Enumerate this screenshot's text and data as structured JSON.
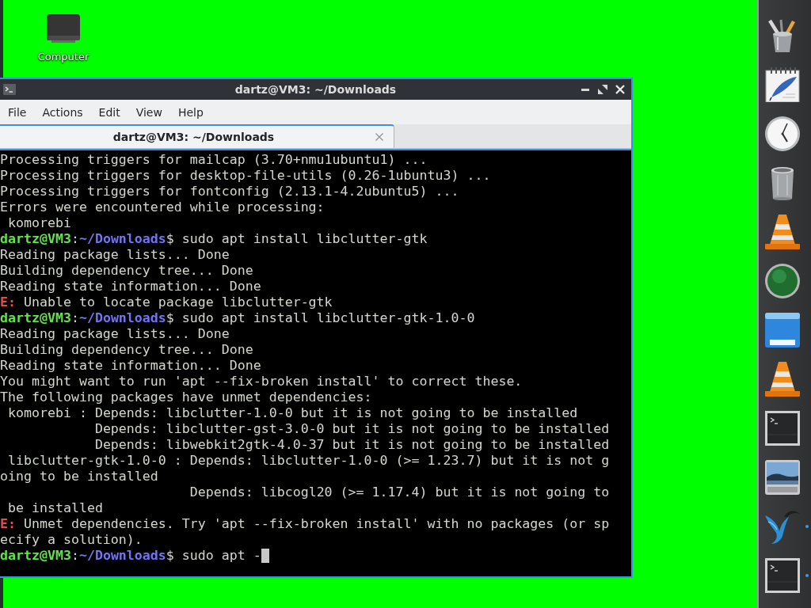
{
  "desktop": {
    "icons": [
      {
        "label": "Computer"
      }
    ]
  },
  "window": {
    "title": "dartz@VM3: ~/Downloads",
    "menu": [
      "File",
      "Actions",
      "Edit",
      "View",
      "Help"
    ],
    "tabs": [
      {
        "label": "dartz@VM3: ~/Downloads",
        "selected": true
      }
    ],
    "terminal": {
      "cursor": true,
      "lines": [
        {
          "segments": [
            {
              "kind": "plain",
              "text": "Processing triggers for mailcap (3.70+nmu1ubuntu1) ..."
            }
          ]
        },
        {
          "segments": [
            {
              "kind": "plain",
              "text": "Processing triggers for desktop-file-utils (0.26-1ubuntu3) ..."
            }
          ]
        },
        {
          "segments": [
            {
              "kind": "plain",
              "text": "Processing triggers for fontconfig (2.13.1-4.2ubuntu5) ..."
            }
          ]
        },
        {
          "segments": [
            {
              "kind": "plain",
              "text": "Errors were encountered while processing:"
            }
          ]
        },
        {
          "segments": [
            {
              "kind": "plain",
              "text": " komorebi"
            }
          ]
        },
        {
          "segments": [
            {
              "kind": "user",
              "text": "dartz@VM3"
            },
            {
              "kind": "plain",
              "text": ":"
            },
            {
              "kind": "path",
              "text": "~/Downloads"
            },
            {
              "kind": "plain",
              "text": "$ sudo apt install libclutter-gtk"
            }
          ]
        },
        {
          "segments": [
            {
              "kind": "plain",
              "text": "Reading package lists... Done"
            }
          ]
        },
        {
          "segments": [
            {
              "kind": "plain",
              "text": "Building dependency tree... Done"
            }
          ]
        },
        {
          "segments": [
            {
              "kind": "plain",
              "text": "Reading state information... Done"
            }
          ]
        },
        {
          "segments": [
            {
              "kind": "error",
              "text": "E:"
            },
            {
              "kind": "plain",
              "text": " Unable to locate package libclutter-gtk"
            }
          ]
        },
        {
          "segments": [
            {
              "kind": "user",
              "text": "dartz@VM3"
            },
            {
              "kind": "plain",
              "text": ":"
            },
            {
              "kind": "path",
              "text": "~/Downloads"
            },
            {
              "kind": "plain",
              "text": "$ sudo apt install libclutter-gtk-1.0-0"
            }
          ]
        },
        {
          "segments": [
            {
              "kind": "plain",
              "text": "Reading package lists... Done"
            }
          ]
        },
        {
          "segments": [
            {
              "kind": "plain",
              "text": "Building dependency tree... Done"
            }
          ]
        },
        {
          "segments": [
            {
              "kind": "plain",
              "text": "Reading state information... Done"
            }
          ]
        },
        {
          "segments": [
            {
              "kind": "plain",
              "text": "You might want to run 'apt --fix-broken install' to correct these."
            }
          ]
        },
        {
          "segments": [
            {
              "kind": "plain",
              "text": "The following packages have unmet dependencies:"
            }
          ]
        },
        {
          "segments": [
            {
              "kind": "plain",
              "text": " komorebi : Depends: libclutter-1.0-0 but it is not going to be installed"
            }
          ]
        },
        {
          "segments": [
            {
              "kind": "plain",
              "text": "            Depends: libclutter-gst-3.0-0 but it is not going to be installed"
            }
          ]
        },
        {
          "segments": [
            {
              "kind": "plain",
              "text": "            Depends: libwebkit2gtk-4.0-37 but it is not going to be installed"
            }
          ]
        },
        {
          "segments": [
            {
              "kind": "plain",
              "text": " libclutter-gtk-1.0-0 : Depends: libclutter-1.0-0 (>= 1.23.7) but it is not g"
            }
          ]
        },
        {
          "segments": [
            {
              "kind": "plain",
              "text": "oing to be installed"
            }
          ]
        },
        {
          "segments": [
            {
              "kind": "plain",
              "text": "                        Depends: libcogl20 (>= 1.17.4) but it is not going to"
            }
          ]
        },
        {
          "segments": [
            {
              "kind": "plain",
              "text": " be installed"
            }
          ]
        },
        {
          "segments": [
            {
              "kind": "error",
              "text": "E:"
            },
            {
              "kind": "plain",
              "text": " Unmet dependencies. Try 'apt --fix-broken install' with no packages (or sp"
            }
          ]
        },
        {
          "segments": [
            {
              "kind": "plain",
              "text": "ecify a solution)."
            }
          ]
        },
        {
          "segments": [
            {
              "kind": "user",
              "text": "dartz@VM3"
            },
            {
              "kind": "plain",
              "text": ":"
            },
            {
              "kind": "path",
              "text": "~/Downloads"
            },
            {
              "kind": "plain",
              "text": "$ sudo apt -"
            }
          ]
        }
      ]
    }
  },
  "dock": {
    "items": [
      {
        "kind": "pencils",
        "running": false
      },
      {
        "kind": "notepad",
        "running": false
      },
      {
        "kind": "clock",
        "running": false
      },
      {
        "kind": "trash",
        "running": false
      },
      {
        "kind": "cone",
        "running": false
      },
      {
        "kind": "orb",
        "running": false
      },
      {
        "kind": "panel",
        "running": false
      },
      {
        "kind": "cone",
        "running": false
      },
      {
        "kind": "terminal",
        "running": false
      },
      {
        "kind": "photo",
        "running": false
      },
      {
        "kind": "bird",
        "running": true
      },
      {
        "kind": "terminal",
        "running": true
      }
    ]
  }
}
